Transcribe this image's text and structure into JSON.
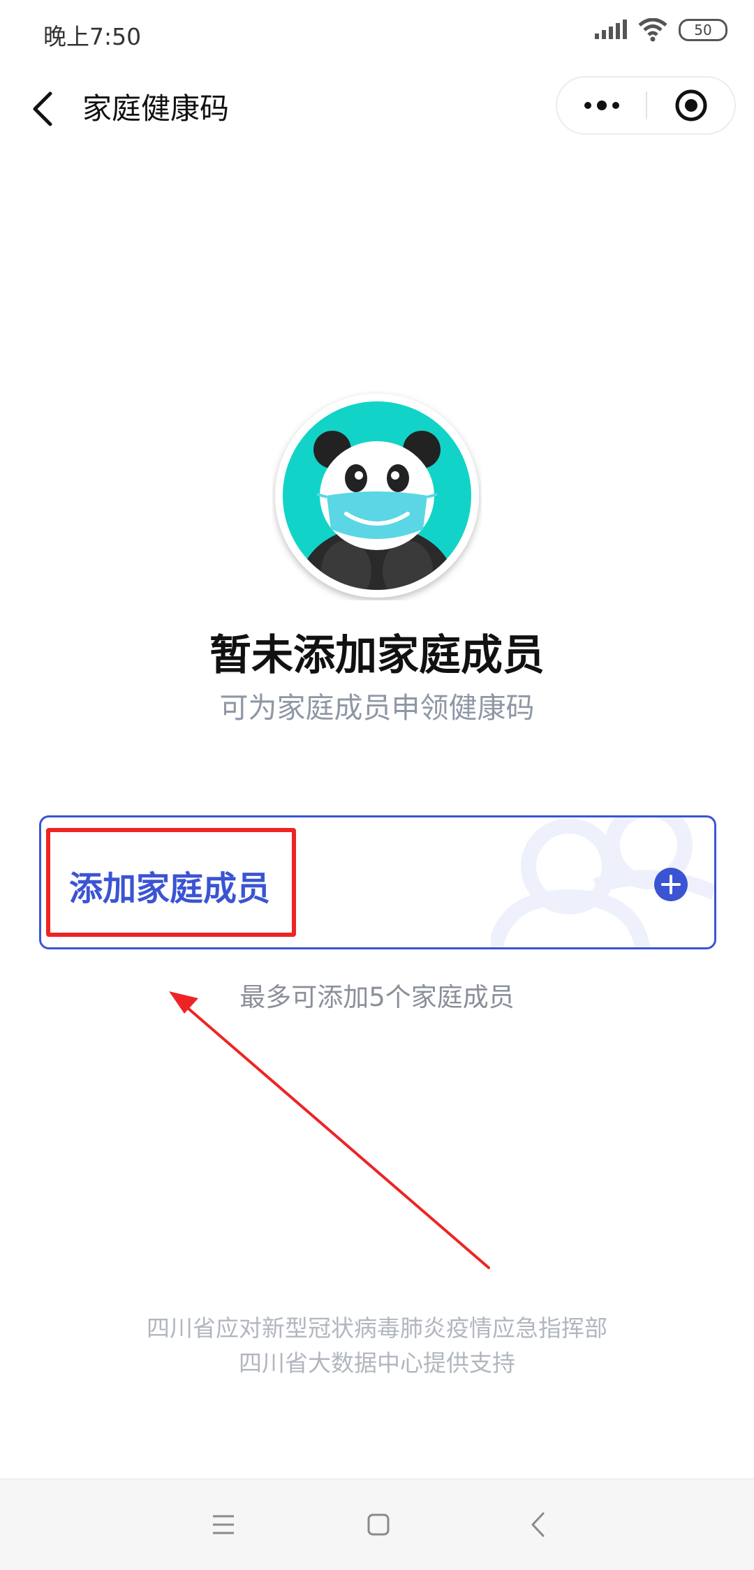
{
  "status_bar": {
    "time": "晚上7:50",
    "battery": "50"
  },
  "nav": {
    "title": "家庭健康码"
  },
  "empty_state": {
    "title": "暂未添加家庭成员",
    "subtitle": "可为家庭成员申领健康码"
  },
  "add_member": {
    "label": "添加家庭成员",
    "limit_note": "最多可添加5个家庭成员"
  },
  "footer": {
    "line1": "四川省应对新型冠状病毒肺炎疫情应急指挥部",
    "line2": "四川省大数据中心提供支持"
  },
  "colors": {
    "accent": "#3b54d3",
    "annotation": "#ee2424",
    "avatar_bg": "#12d3c7"
  },
  "icons": [
    "back-icon",
    "more-icon",
    "close-target-icon",
    "plus-icon",
    "menu-icon",
    "home-icon",
    "nav-back-icon",
    "signal-icon",
    "wifi-icon"
  ]
}
